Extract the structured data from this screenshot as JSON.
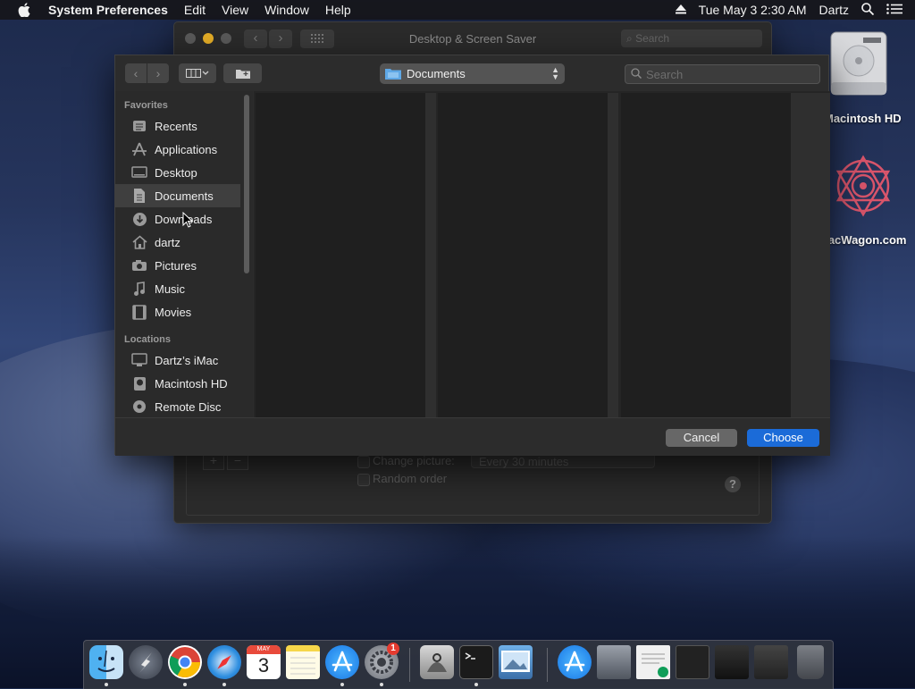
{
  "menubar": {
    "app_name": "System Preferences",
    "items": [
      "Edit",
      "View",
      "Window",
      "Help"
    ],
    "clock": "Tue May 3  2:30 AM",
    "user": "Dartz"
  },
  "desktop": {
    "icons": [
      {
        "label": "Macintosh HD"
      },
      {
        "label": "MacWagon.com"
      }
    ]
  },
  "pref_window": {
    "title": "Desktop & Screen Saver",
    "search_placeholder": "Search",
    "change_picture_label": "Change picture:",
    "change_picture_value": "Every 30 minutes",
    "random_order_label": "Random order",
    "help": "?"
  },
  "sheet": {
    "location": "Documents",
    "search_placeholder": "Search",
    "sidebar": {
      "favorites_header": "Favorites",
      "favorites": [
        {
          "label": "Recents",
          "icon": "recents-icon"
        },
        {
          "label": "Applications",
          "icon": "applications-icon"
        },
        {
          "label": "Desktop",
          "icon": "desktop-icon"
        },
        {
          "label": "Documents",
          "icon": "documents-icon",
          "selected": true
        },
        {
          "label": "Downloads",
          "icon": "downloads-icon"
        },
        {
          "label": "dartz",
          "icon": "home-icon"
        },
        {
          "label": "Pictures",
          "icon": "pictures-icon"
        },
        {
          "label": "Music",
          "icon": "music-icon"
        },
        {
          "label": "Movies",
          "icon": "movies-icon"
        }
      ],
      "locations_header": "Locations",
      "locations": [
        {
          "label": "Dartz’s iMac",
          "icon": "imac-icon"
        },
        {
          "label": "Macintosh HD",
          "icon": "disk-icon"
        },
        {
          "label": "Remote Disc",
          "icon": "disc-icon"
        }
      ]
    },
    "cancel_label": "Cancel",
    "choose_label": "Choose"
  },
  "dock": {
    "calendar_month": "MAY",
    "calendar_day": "3",
    "prefs_badge": "1",
    "apps": [
      "finder-icon",
      "launchpad-icon",
      "chrome-icon",
      "safari-icon",
      "calendar-icon",
      "notes-icon",
      "app-store-icon",
      "system-preferences-icon",
      "disk-utility-icon",
      "terminal-icon",
      "preview-icon",
      "app-store-folder-icon",
      "photo-icon",
      "document-icon",
      "window-icon",
      "screenshot-icon",
      "stack-icon",
      "trash-icon"
    ]
  }
}
